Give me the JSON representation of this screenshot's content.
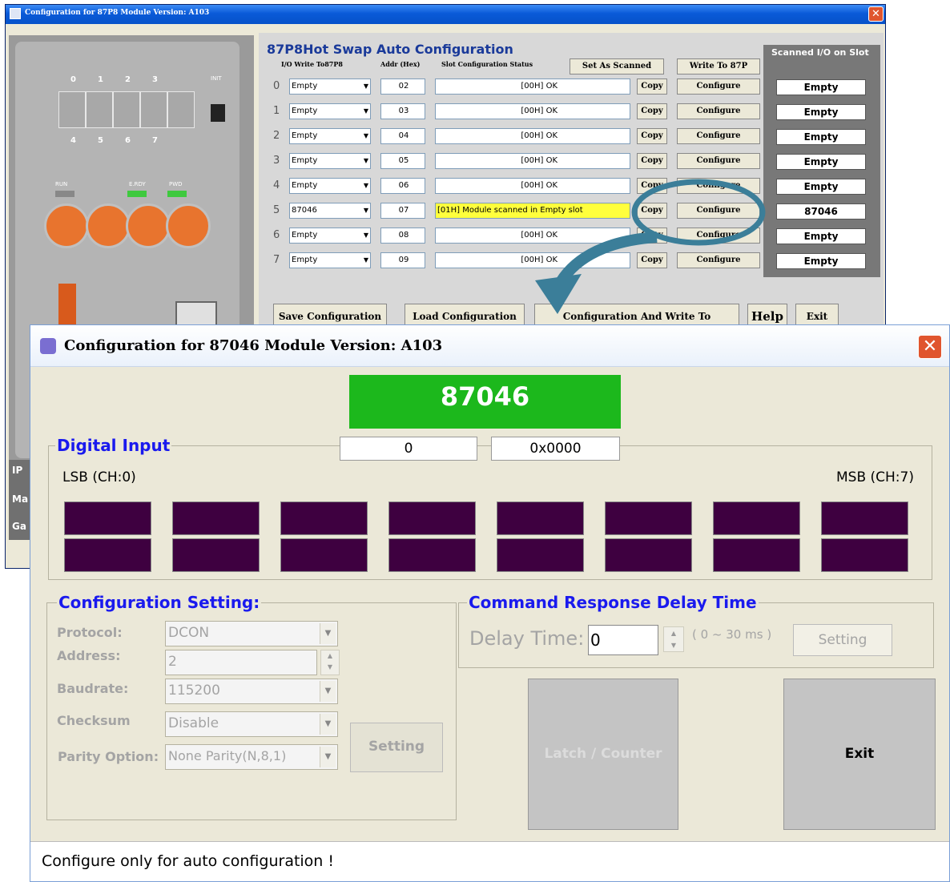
{
  "back_window": {
    "title": "Configuration for 87P8 Module Version: A103",
    "panel_title": "87P8Hot Swap Auto Configuration",
    "col_io": "I/O Write To87P8",
    "col_addr": "Addr (Hex)",
    "col_status": "Slot Configuration Status",
    "set_as_scanned": "Set As Scanned",
    "write_to_87p": "Write To 87P",
    "scanned_header": "Scanned I/O on Slot",
    "slot_numbers_top": [
      "0",
      "1",
      "2",
      "3"
    ],
    "slot_numbers_bottom": [
      "4",
      "5",
      "6",
      "7"
    ],
    "init_label": "INIT",
    "led_labels": [
      "RUN",
      "E.RDY",
      "PWD"
    ],
    "rows": [
      {
        "idx": "0",
        "io": "Empty",
        "addr": "02",
        "status": "[00H] OK",
        "scanned": "Empty"
      },
      {
        "idx": "1",
        "io": "Empty",
        "addr": "03",
        "status": "[00H] OK",
        "scanned": "Empty"
      },
      {
        "idx": "2",
        "io": "Empty",
        "addr": "04",
        "status": "[00H] OK",
        "scanned": "Empty"
      },
      {
        "idx": "3",
        "io": "Empty",
        "addr": "05",
        "status": "[00H] OK",
        "scanned": "Empty"
      },
      {
        "idx": "4",
        "io": "Empty",
        "addr": "06",
        "status": "[00H] OK",
        "scanned": "Empty"
      },
      {
        "idx": "5",
        "io": "87046",
        "addr": "07",
        "status": "[01H] Module scanned in Empty slot",
        "scanned": "87046"
      },
      {
        "idx": "6",
        "io": "Empty",
        "addr": "08",
        "status": "[00H] OK",
        "scanned": "Empty"
      },
      {
        "idx": "7",
        "io": "Empty",
        "addr": "09",
        "status": "[00H] OK",
        "scanned": "Empty"
      }
    ],
    "copy_label": "Copy",
    "configure_label": "Configure",
    "save_config": "Save Configuration",
    "load_config": "Load Configuration",
    "load_write": "Configuration And Write To",
    "help": "Help",
    "exit": "Exit",
    "side_labels": [
      "IP",
      "Ma",
      "Ga"
    ],
    "highlight_color": "#3b7e99"
  },
  "dialog": {
    "title": "Configuration for 87046 Module Version: A103",
    "module_name": "87046",
    "digital_input": {
      "legend": "Digital Input",
      "value_dec": "0",
      "value_hex": "0x0000",
      "lsb_label": "LSB (CH:0)",
      "msb_label": "MSB (CH:7)",
      "channel_count": 8
    },
    "config_setting": {
      "legend": "Configuration Setting:",
      "protocol_label": "Protocol:",
      "protocol_value": "DCON",
      "address_label": "Address:",
      "address_value": "2",
      "baudrate_label": "Baudrate:",
      "baudrate_value": "115200",
      "checksum_label": "Checksum",
      "checksum_value": "Disable",
      "parity_label": "Parity Option:",
      "parity_value": "None Parity(N,8,1)",
      "setting_button": "Setting"
    },
    "delay": {
      "legend": "Command Response Delay Time",
      "label": "Delay Time:",
      "value": "0",
      "range": "( 0 ~ 30 ms )",
      "setting_button": "Setting"
    },
    "latch_counter_button": "Latch / Counter",
    "exit_button": "Exit",
    "status_text": "Configure only for auto configuration !"
  }
}
